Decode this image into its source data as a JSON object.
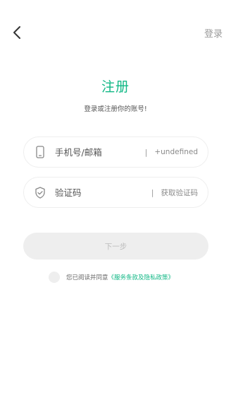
{
  "header": {
    "back_icon": "chevron-left-icon",
    "login_label": "登录"
  },
  "main": {
    "title": "注册",
    "subtitle": "登录或注册你的账号!"
  },
  "fields": {
    "phone": {
      "icon": "phone-icon",
      "placeholder": "手机号/邮箱",
      "separator": "|",
      "suffix": "+undefined"
    },
    "code": {
      "icon": "shield-icon",
      "placeholder": "验证码",
      "separator": "|",
      "suffix": "获取验证码"
    }
  },
  "next_button": {
    "label": "下一步"
  },
  "agreement": {
    "text": "您已阅读并同意",
    "link": "《服务条款及隐私政策》"
  },
  "colors": {
    "accent": "#12b886",
    "muted": "#9a9a9a",
    "field_border": "#eeeeee",
    "button_bg": "#eeeeee"
  }
}
